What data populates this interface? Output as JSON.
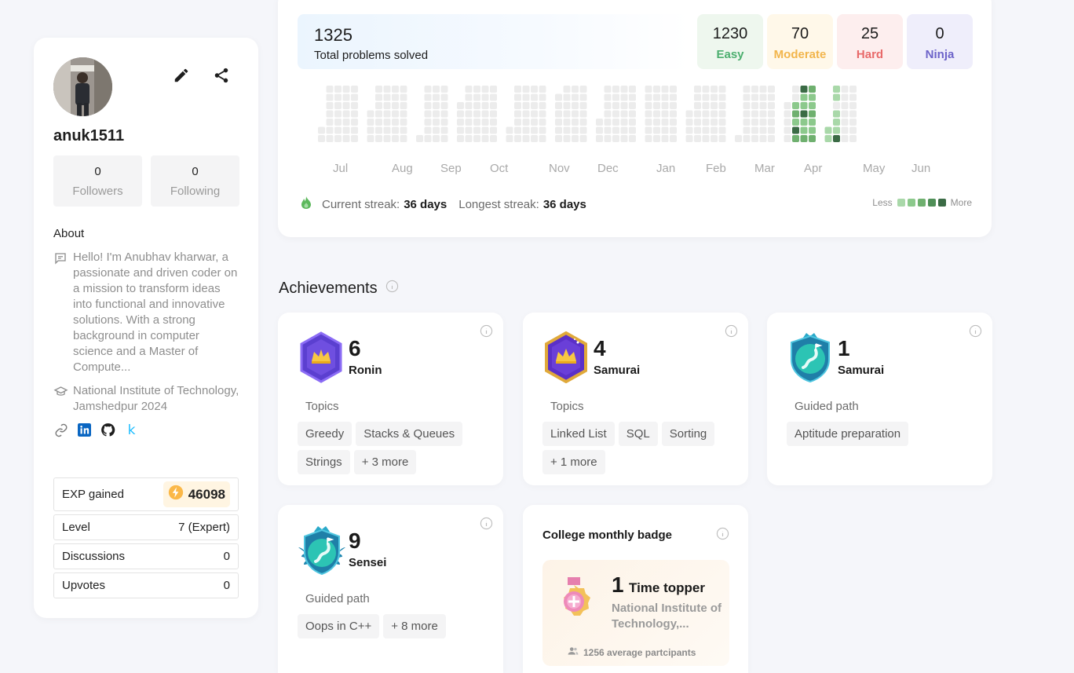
{
  "profile": {
    "username": "anuk1511",
    "followers_count": "0",
    "followers_label": "Followers",
    "following_count": "0",
    "following_label": "Following",
    "about_heading": "About",
    "about_text": "Hello! I'm Anubhav kharwar, a passionate and driven coder on a mission to transform ideas into functional and innovative solutions. With a strong background in computer science and a Master of Compute...",
    "education": "National Institute of Technology, Jamshedpur 2024",
    "stats": {
      "exp_label": "EXP gained",
      "exp_value": "46098",
      "level_label": "Level",
      "level_value": "7 (Expert)",
      "discussions_label": "Discussions",
      "discussions_value": "0",
      "upvotes_label": "Upvotes",
      "upvotes_value": "0"
    }
  },
  "activity": {
    "total": "1325",
    "total_label": "Total problems solved",
    "difficulty": [
      {
        "count": "1230",
        "label": "Easy",
        "color": "#4caf6f",
        "bg": "#eef7ee"
      },
      {
        "count": "70",
        "label": "Moderate",
        "color": "#f2b54b",
        "bg": "#fff8e9"
      },
      {
        "count": "25",
        "label": "Hard",
        "color": "#e86a6a",
        "bg": "#fdeeee"
      },
      {
        "count": "0",
        "label": "Ninja",
        "color": "#6c63c9",
        "bg": "#efeefb"
      }
    ],
    "months": [
      "Jul",
      "Aug",
      "Sep",
      "Oct",
      "Nov",
      "Dec",
      "Jan",
      "Feb",
      "Mar",
      "Apr",
      "May",
      "Jun"
    ],
    "current_streak_label": "Current streak:",
    "current_streak": "36 days",
    "longest_streak_label": "Longest streak:",
    "longest_streak": "36 days",
    "legend_less": "Less",
    "legend_more": "More",
    "legend_colors": [
      "#a9d8a9",
      "#8cc98c",
      "#6fb06f",
      "#4f8f57",
      "#3b6b45"
    ]
  },
  "achievements": {
    "title": "Achievements",
    "cards": [
      {
        "count": "6",
        "rank": "Ronin",
        "category": "Topics",
        "chips": [
          "Greedy",
          "Stacks & Queues",
          "Strings",
          "+ 3 more"
        ],
        "badge": "ronin-hexagon-badge"
      },
      {
        "count": "4",
        "rank": "Samurai",
        "category": "Topics",
        "chips": [
          "Linked List",
          "SQL",
          "Sorting",
          "+ 1 more"
        ],
        "badge": "samurai-hexagon-badge"
      },
      {
        "count": "1",
        "rank": "Samurai",
        "category": "Guided path",
        "chips": [
          "Aptitude preparation"
        ],
        "badge": "samurai-shield-badge"
      },
      {
        "count": "9",
        "rank": "Sensei",
        "category": "Guided path",
        "chips": [
          "Oops in C++",
          "+ 8 more"
        ],
        "badge": "sensei-winged-badge"
      }
    ],
    "college_badge": {
      "title": "College monthly badge",
      "count": "1",
      "label": "Time topper",
      "college": "National Institute of Technology,...",
      "participants": "1256 average partcipants"
    }
  }
}
